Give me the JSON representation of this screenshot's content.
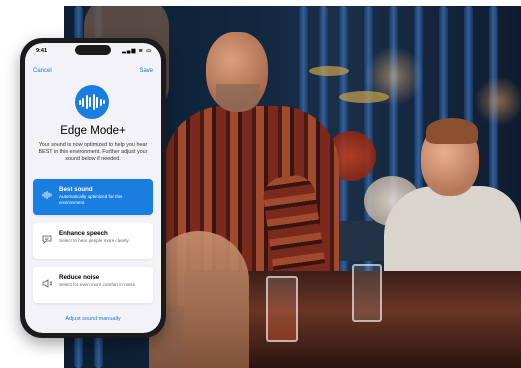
{
  "status_bar": {
    "time": "9:41",
    "icons": "▂▄▆ ≋ ▭"
  },
  "nav": {
    "cancel_label": "Cancel",
    "save_label": "Save"
  },
  "header": {
    "title": "Edge Mode+",
    "description": "Your sound is now optimized to help you hear BEST in this environment. Further adjust your sound below if needed."
  },
  "options": [
    {
      "title": "Best sound",
      "subtitle": "Automatically optimized for this environment",
      "selected": true,
      "icon": "waveform-icon"
    },
    {
      "title": "Enhance speech",
      "subtitle": "Select to hear people more clearly",
      "selected": false,
      "icon": "speech-bubble-icon"
    },
    {
      "title": "Reduce noise",
      "subtitle": "Select for even more comfort in noise",
      "selected": false,
      "icon": "speaker-icon"
    }
  ],
  "footer": {
    "manual_link": "Adjust sound manually"
  },
  "colors": {
    "accent": "#1a7de0",
    "screen_bg": "#f2f2f7"
  }
}
